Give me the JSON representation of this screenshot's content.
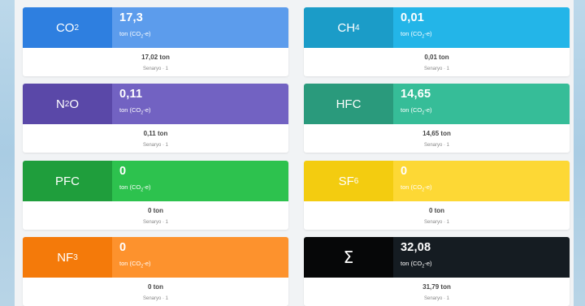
{
  "unit_prefix": "ton (CO",
  "unit_sub": "2",
  "unit_suffix": "-e)",
  "cards": [
    {
      "gas_pre": "CO",
      "gas_sub": "2",
      "value": "17,3",
      "total": "17,02 ton",
      "scenario": "Senaryo · 1",
      "left_color": "#2e7fe0",
      "right_color": "#5c9cec"
    },
    {
      "gas_pre": "CH",
      "gas_sub": "4",
      "value": "0,01",
      "total": "0,01 ton",
      "scenario": "Senaryo · 1",
      "left_color": "#1b9cc8",
      "right_color": "#23b5e8"
    },
    {
      "gas_pre": "N",
      "gas_sub": "2",
      "gas_post": "O",
      "value": "0,11",
      "total": "0,11 ton",
      "scenario": "Senaryo · 1",
      "left_color": "#5a48a8",
      "right_color": "#7262c2"
    },
    {
      "gas_pre": "HFC",
      "value": "14,65",
      "total": "14,65 ton",
      "scenario": "Senaryo · 1",
      "left_color": "#2a9a7c",
      "right_color": "#36bd98"
    },
    {
      "gas_pre": "PFC",
      "value": "0",
      "total": "0 ton",
      "scenario": "Senaryo · 1",
      "left_color": "#1f9e3c",
      "right_color": "#2dc24e"
    },
    {
      "gas_pre": "SF",
      "gas_sub": "6",
      "value": "0",
      "total": "0 ton",
      "scenario": "Senaryo · 1",
      "left_color": "#f3cc10",
      "right_color": "#fdd835"
    },
    {
      "gas_pre": "NF",
      "gas_sub": "3",
      "value": "0",
      "total": "0 ton",
      "scenario": "Senaryo · 1",
      "left_color": "#f47a0a",
      "right_color": "#fd922d"
    },
    {
      "gas_pre": "Σ",
      "value": "32,08",
      "total": "31,79 ton",
      "scenario": "Senaryo · 1",
      "left_color": "#060708",
      "right_color": "#151c22"
    }
  ]
}
